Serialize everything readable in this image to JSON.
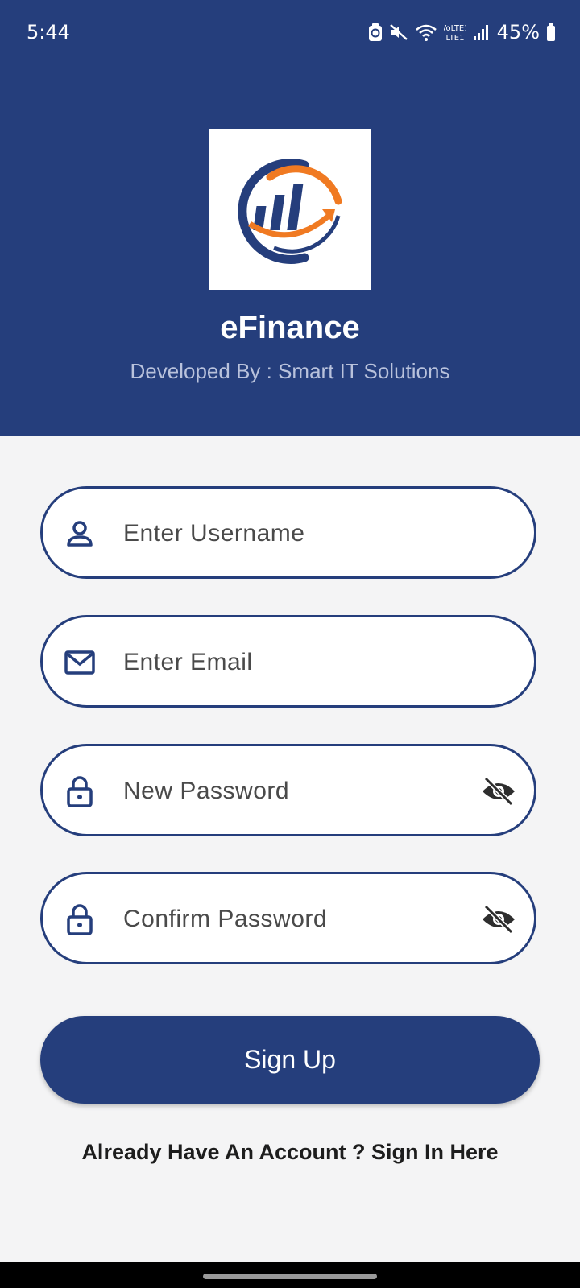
{
  "status_bar": {
    "time": "5:44",
    "network_label": "VoLTE1",
    "battery": "45%",
    "icons": [
      "battery-saver-icon",
      "mute-icon",
      "wifi-icon",
      "volte-icon",
      "signal-icon",
      "battery-icon"
    ]
  },
  "header": {
    "app_title": "eFinance",
    "subtitle": "Developed By : Smart IT Solutions",
    "background_color": "#253e7c"
  },
  "form": {
    "username": {
      "placeholder": "Enter Username",
      "value": "",
      "icon": "person-icon"
    },
    "email": {
      "placeholder": "Enter Email",
      "value": "",
      "icon": "mail-icon"
    },
    "new_password": {
      "placeholder": "New Password",
      "value": "",
      "icon": "lock-icon",
      "toggle_icon": "eye-off-icon"
    },
    "confirm_password": {
      "placeholder": "Confirm Password",
      "value": "",
      "icon": "lock-icon",
      "toggle_icon": "eye-off-icon"
    }
  },
  "actions": {
    "signup_label": "Sign Up",
    "signin_link": "Already Have An Account ? Sign In Here"
  },
  "colors": {
    "primary": "#253e7c",
    "accent": "#f07a22",
    "background": "#f4f4f5"
  }
}
